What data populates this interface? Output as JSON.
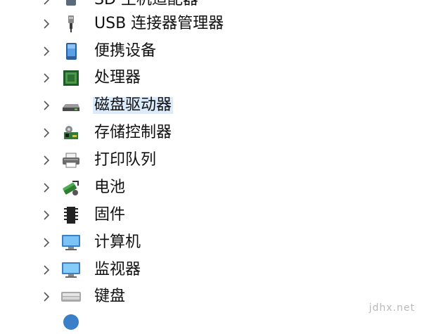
{
  "device_tree": {
    "items": [
      {
        "label": "SD 主机适配器",
        "icon": "sd-host-icon"
      },
      {
        "label": "USB 连接器管理器",
        "icon": "usb-connector-icon"
      },
      {
        "label": "便携设备",
        "icon": "portable-device-icon"
      },
      {
        "label": "处理器",
        "icon": "processor-icon"
      },
      {
        "label": "磁盘驱动器",
        "icon": "disk-drive-icon",
        "selected": true
      },
      {
        "label": "存储控制器",
        "icon": "storage-controller-icon"
      },
      {
        "label": "打印队列",
        "icon": "printer-icon"
      },
      {
        "label": "电池",
        "icon": "battery-icon"
      },
      {
        "label": "固件",
        "icon": "firmware-icon"
      },
      {
        "label": "计算机",
        "icon": "computer-icon"
      },
      {
        "label": "监视器",
        "icon": "monitor-icon"
      },
      {
        "label": "键盘",
        "icon": "keyboard-icon"
      }
    ]
  },
  "watermark": "jdhx.net",
  "colors": {
    "selection": "#dcebfb",
    "chevron": "#555555",
    "text": "#111111"
  }
}
